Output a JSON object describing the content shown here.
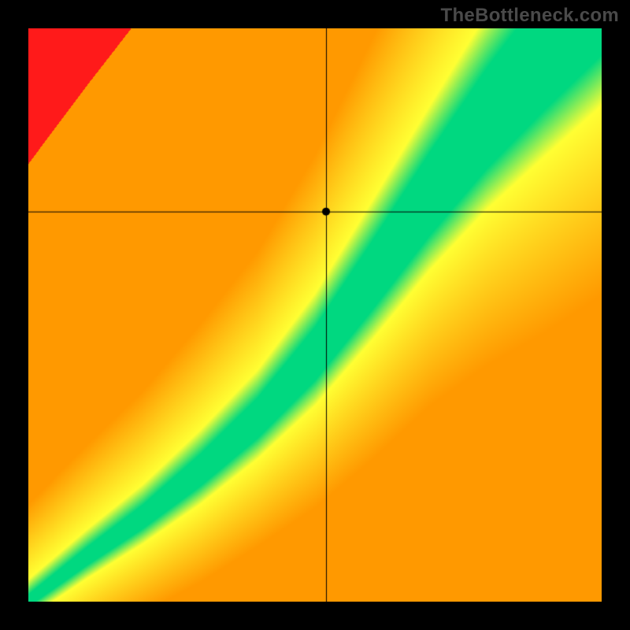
{
  "watermark": "TheBottleneck.com",
  "chart_data": {
    "type": "heatmap",
    "title": "",
    "xlabel": "",
    "ylabel": "",
    "xlim": [
      0,
      1
    ],
    "ylim": [
      0,
      1
    ],
    "crosshair": {
      "x": 0.52,
      "y": 0.68
    },
    "point": {
      "x": 0.52,
      "y": 0.68
    },
    "optimal_band": {
      "description": "Green band: ideal match region. y ≈ optimal(x). Band widens with x.",
      "controls_x": [
        0.0,
        0.1,
        0.2,
        0.3,
        0.4,
        0.5,
        0.6,
        0.7,
        0.8,
        0.9,
        1.0
      ],
      "center_y": [
        0.0,
        0.075,
        0.145,
        0.225,
        0.315,
        0.425,
        0.56,
        0.7,
        0.83,
        0.945,
        1.05
      ],
      "half_width": [
        0.01,
        0.015,
        0.02,
        0.027,
        0.034,
        0.045,
        0.058,
        0.07,
        0.085,
        0.1,
        0.11
      ]
    },
    "colors": {
      "optimal": "#00d880",
      "near": "#ffff33",
      "mid": "#ff9900",
      "far": "#ff1a1a",
      "crosshair": "#000000",
      "point": "#000000"
    }
  }
}
